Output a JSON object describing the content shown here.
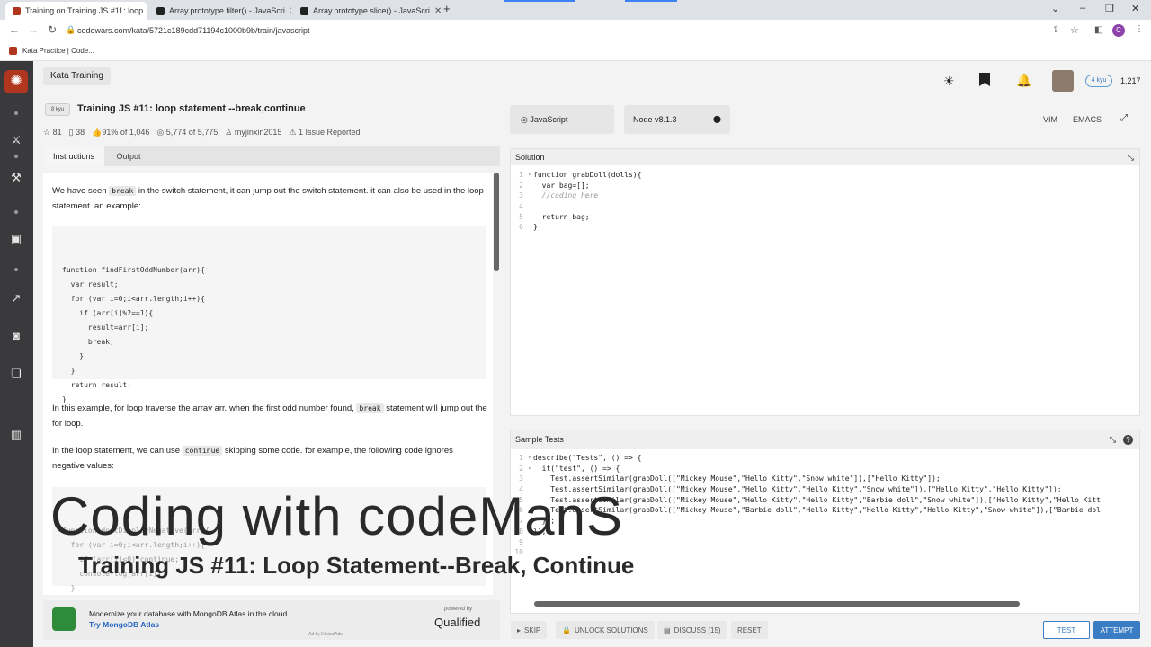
{
  "browser": {
    "tabs": [
      {
        "title": "Training on Training JS #11: loop",
        "favicon_color": "#b1361e"
      },
      {
        "title": "Array.prototype.filter() - JavaScri",
        "favicon_color": "#222"
      },
      {
        "title": "Array.prototype.slice() - JavaScri",
        "favicon_color": "#222"
      }
    ],
    "url": "codewars.com/kata/5721c189cdd71194c1000b9b/train/javascript",
    "bookmark": "Kata Practice | Code...",
    "profile_letter": "C"
  },
  "header": {
    "section": "Kata Training",
    "rank": "4 kyu",
    "honor": "1,217"
  },
  "kata": {
    "kyu": "8 kyu",
    "title": "Training JS #11: loop statement --break,continue",
    "stars": "81",
    "bookmarks": "38",
    "satisfaction": "91% of 1,046",
    "completed": "5,774 of 5,775",
    "author": "myjinxin2015",
    "issues": "1 Issue Reported"
  },
  "desc_tabs": [
    "Instructions",
    "Output"
  ],
  "instructions": {
    "p1_a": "We have seen ",
    "p1_code": "break",
    "p1_b": " in the switch statement, it can jump out the switch statement. it can also be used in the loop statement. an example:",
    "code1": [
      "function findFirstOddNumber(arr){",
      "  var result;",
      "  for (var i=0;i<arr.length;i++){",
      "    if (arr[i]%2==1){",
      "      result=arr[i];",
      "      break;",
      "    }",
      "  }",
      "  return result;",
      "}"
    ],
    "p2_a": "In this example, for loop traverse the array arr. when the first odd number found, ",
    "p2_code": "break",
    "p2_b": " statement will jump out the for loop.",
    "p3_a": "In the loop statement, we can use ",
    "p3_code": "continue",
    "p3_b": " skipping some code. for example, the following code ignores negative values:",
    "code2": [
      "function dontDisplayNegative(arr){",
      "  for (var i=0;i<arr.length;i++){",
      "    if (arr[i]<0) continue;",
      "    console.log(arr[i])",
      "  }",
      "}"
    ]
  },
  "ad": {
    "text": "Modernize your database with MongoDB Atlas in the cloud. ",
    "link": "Try MongoDB Atlas",
    "powered": "powered by",
    "brand": "Qualified",
    "ethical": "Ad by EthicalAds"
  },
  "editor": {
    "language": "JavaScript",
    "version": "Node v8.1.3",
    "vim": "VIM",
    "emacs": "EMACS",
    "solution_label": "Solution",
    "solution_lines": [
      "function grabDoll(dolls){",
      "  var bag=[];",
      "  //coding here",
      "",
      "  return bag;",
      "}"
    ],
    "tests_label": "Sample Tests",
    "test_lines": [
      "describe(\"Tests\", () => {",
      "  it(\"test\", () => {",
      "    Test.assertSimilar(grabDoll([\"Mickey Mouse\",\"Hello Kitty\",\"Snow white\"]),[\"Hello Kitty\"]);",
      "    Test.assertSimilar(grabDoll([\"Mickey Mouse\",\"Hello Kitty\",\"Hello Kitty\",\"Snow white\"]),[\"Hello Kitty\",\"Hello Kitty\"]);",
      "    Test.assertSimilar(grabDoll([\"Mickey Mouse\",\"Hello Kitty\",\"Hello Kitty\",\"Barbie doll\",\"Snow white\"]),[\"Hello Kitty\",\"Hello Kitt",
      "    Test.assertSimilar(grabDoll([\"Mickey Mouse\",\"Barbie doll\",\"Hello Kitty\",\"Hello Kitty\",\"Hello Kitty\",\"Snow white\"]),[\"Barbie dol",
      "  });",
      "});",
      "",
      ""
    ]
  },
  "actions": {
    "skip": "SKIP",
    "unlock": "UNLOCK SOLUTIONS",
    "discuss": "DISCUSS (15)",
    "reset": "RESET",
    "test": "TEST",
    "attempt": "ATTEMPT"
  },
  "overlay": {
    "title": "Coding with codeManS",
    "subtitle": "Training JS #11: Loop Statement--Break, Continue"
  }
}
